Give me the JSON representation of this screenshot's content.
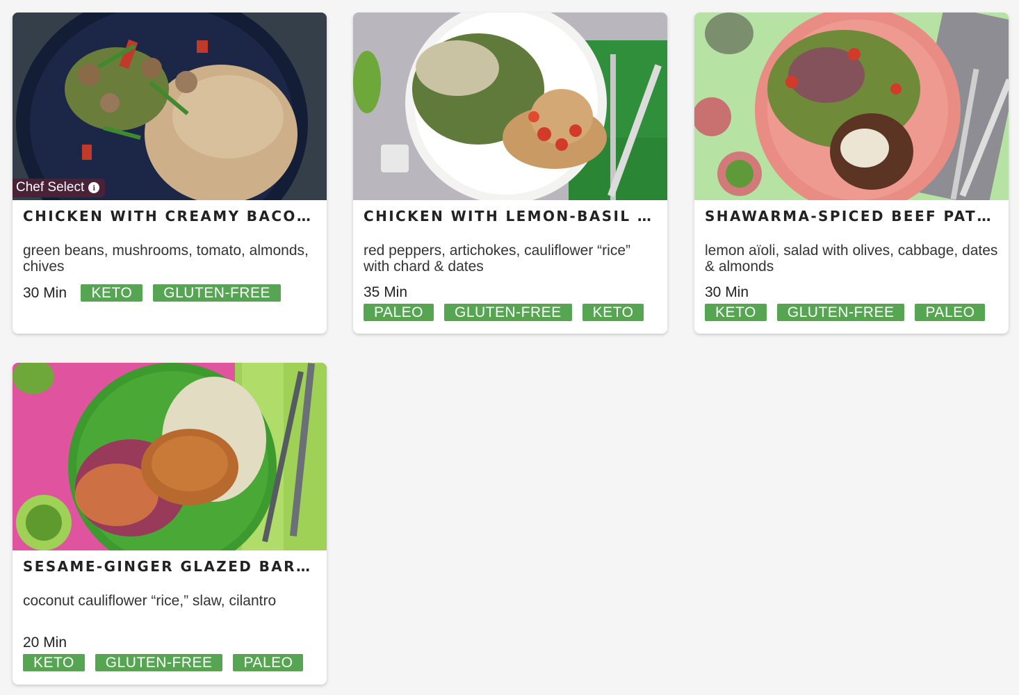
{
  "colors": {
    "tag_bg": "#55a552",
    "chef_badge_bg": "#4a2136",
    "page_bg": "#f5f5f5"
  },
  "cards": [
    {
      "title": "CHICKEN WITH CREAMY BACON…",
      "description": "green beans, mushrooms, tomato, almonds, chives",
      "time": "30 Min",
      "tags": [
        "KETO",
        "GLUTEN-FREE"
      ],
      "badge": "Chef Select",
      "badge_icon": "info-icon",
      "image": "chicken-creamy-bacon-photo"
    },
    {
      "title": "CHICKEN WITH LEMON-BASIL P…",
      "description": "red peppers, artichokes, cauliflower “rice” with chard & dates",
      "time": "35 Min",
      "tags": [
        "PALEO",
        "GLUTEN-FREE",
        "KETO"
      ],
      "image": "chicken-lemon-basil-photo"
    },
    {
      "title": "SHAWARMA-SPICED BEEF PATTI…",
      "description": "lemon aïoli, salad with olives, cabbage, dates & almonds",
      "time": "30 Min",
      "tags": [
        "KETO",
        "GLUTEN-FREE",
        "PALEO"
      ],
      "image": "shawarma-beef-patty-photo"
    },
    {
      "title": "SESAME-GINGER GLAZED BARR…",
      "description": "coconut cauliflower “rice,” slaw, cilantro",
      "time": "20 Min",
      "tags": [
        "KETO",
        "GLUTEN-FREE",
        "PALEO"
      ],
      "image": "sesame-ginger-barramundi-photo"
    }
  ]
}
